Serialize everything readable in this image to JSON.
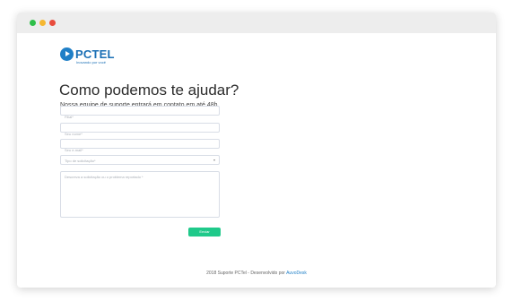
{
  "window": {
    "controls": [
      "close-dot-green",
      "minimize-dot-yellow",
      "maximize-dot-red"
    ]
  },
  "brand": {
    "name": "PCTEL",
    "tagline": "Inovando por você"
  },
  "page": {
    "title": "Como podemos te ajudar?",
    "subtitle": "Nossa equipe de suporte entrará em contato em até 48h"
  },
  "form": {
    "fields": [
      {
        "placeholder": "Filial*",
        "value": ""
      },
      {
        "placeholder": "Seu nome*",
        "value": ""
      },
      {
        "placeholder": "Seu e-mail*",
        "value": ""
      }
    ],
    "request_type": {
      "selected": "Tipo de solicitação*"
    },
    "description": {
      "placeholder": "Descreva a solicitação ou o problema reportado *",
      "value": ""
    },
    "submit_label": "Enviar"
  },
  "footer": {
    "text": "2018 Suporte PCTel - Desenvolvido por",
    "link_text": "AuvoDesk"
  },
  "colors": {
    "accent": "#1fc98a",
    "brand": "#1f7fc7",
    "titlebar": "#ededed"
  }
}
